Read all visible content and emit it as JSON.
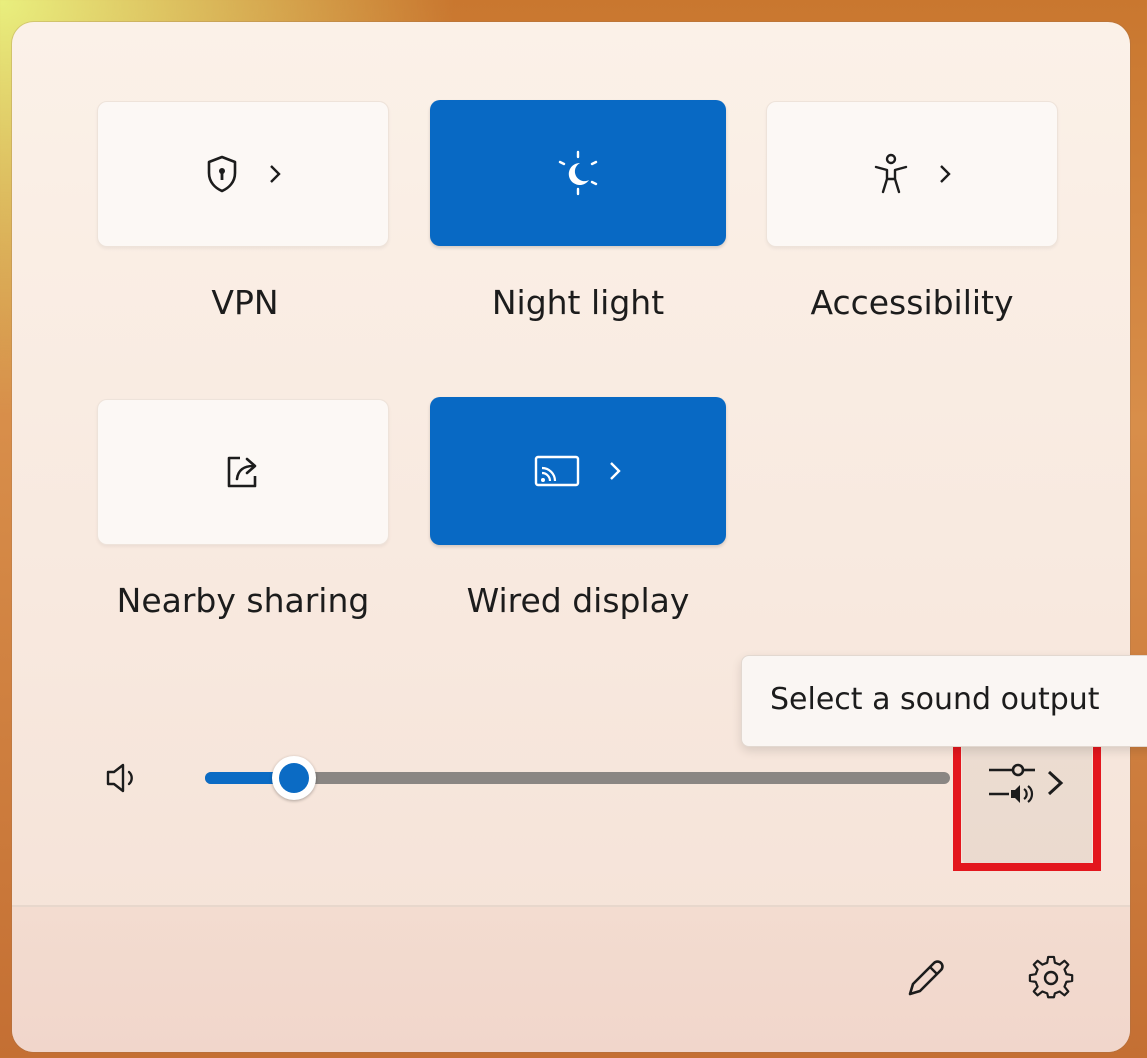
{
  "tiles": [
    {
      "name": "vpn",
      "label": "VPN",
      "state": "off",
      "has_chevron": true,
      "icon": "shield-icon"
    },
    {
      "name": "night-light",
      "label": "Night light",
      "state": "on",
      "has_chevron": false,
      "icon": "night-light-icon"
    },
    {
      "name": "accessibility",
      "label": "Accessibility",
      "state": "off",
      "has_chevron": true,
      "icon": "accessibility-icon"
    },
    {
      "name": "nearby-sharing",
      "label": "Nearby sharing",
      "state": "off",
      "has_chevron": false,
      "icon": "share-icon"
    },
    {
      "name": "wired-display",
      "label": "Wired display",
      "state": "on",
      "has_chevron": true,
      "icon": "cast-icon"
    }
  ],
  "volume": {
    "level": 0.12,
    "icon": "speaker-icon"
  },
  "tooltip": {
    "text": "Select a sound output"
  },
  "sound_output_button": {
    "icon": "sound-output-icon"
  },
  "footer": {
    "edit_icon": "pencil-icon",
    "settings_icon": "gear-icon"
  },
  "colors": {
    "accent": "#0869c4",
    "highlight": "#e3161d"
  }
}
